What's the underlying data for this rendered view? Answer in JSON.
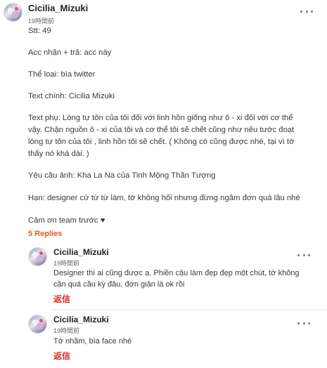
{
  "main_comment": {
    "username": "Cicilia_Mizuki",
    "time": "19時間前",
    "lines": [
      "Stt: 49",
      "Acc nhận + trả: acc này",
      "Thể loại: bìa twitter",
      "Text chính: Cicilia Mizuki",
      "Text phụ: Lòng tự tôn của tôi đối với linh hồn giống như ô - xi đối với cơ thể",
      "vậy. Chặn nguồn ô - xi của tôi và cơ thể tôi sẽ chết cũng như nếu tước đoạt",
      "lòng tự tôn của tôi , linh hồn tôi sẽ chết. ( Không có cũng được nhé, tại vì tớ",
      "thấy nó khá dài. )",
      "Yêu cầu ảnh: Kha La Na của Tinh Mộng Thần Tượng",
      "Hạn: designer cứ từ từ làm, tớ không hối nhưng đừng ngâm đơn quá lâu nhé",
      "Cảm ơn team trước ♥"
    ]
  },
  "replies_link": "5 Replies",
  "replies": [
    {
      "username": "Cicilia_Mizuki",
      "time": "19時間前",
      "lines": [
        "Designer thì ai cũng được ạ. Phiền cậu làm đẹp đẹp một chút, tớ không",
        "cần quá cầu kỳ đâu, đơn giản là ok rồi"
      ],
      "reply_label": "返信"
    },
    {
      "username": "Cicilia_Mizuki",
      "time": "19時間前",
      "lines": [
        "Tớ nhầm, bìa face nhé"
      ],
      "reply_label": "返信"
    }
  ]
}
